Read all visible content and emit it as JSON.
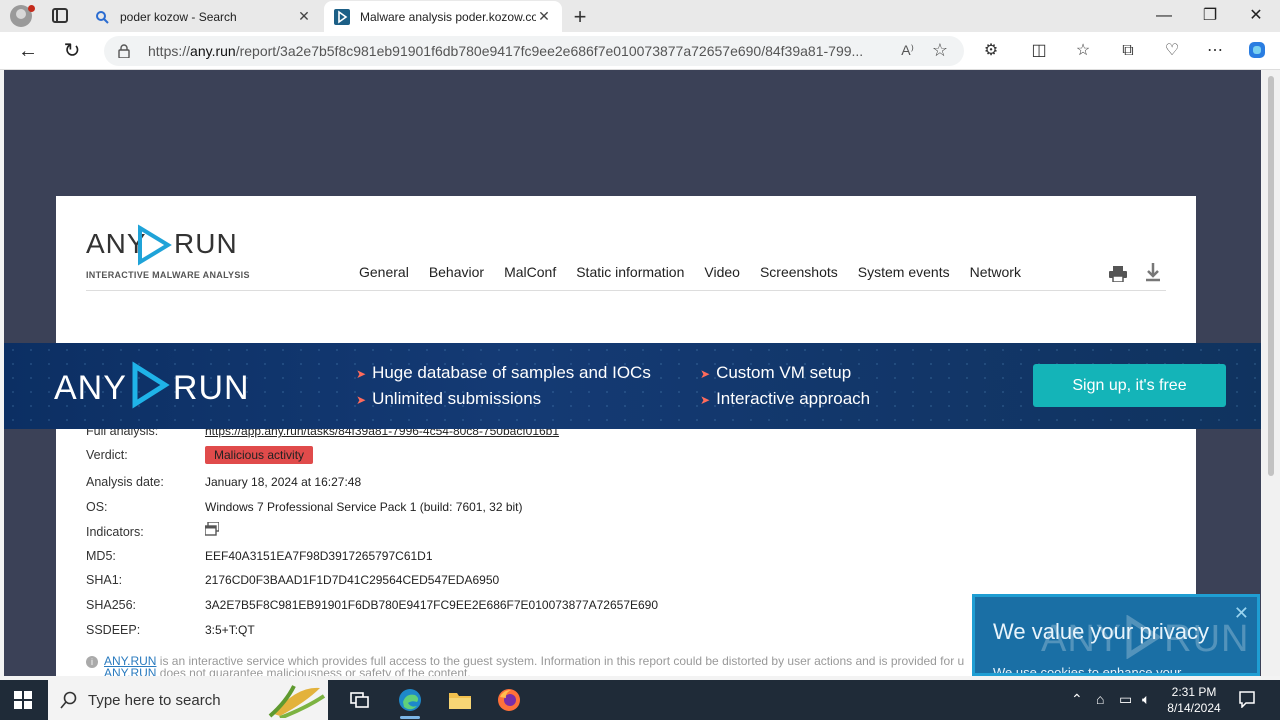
{
  "browser": {
    "tabs": [
      {
        "label": "poder kozow - Search",
        "icon": "search-icon"
      },
      {
        "label": "Malware analysis poder.kozow.co",
        "icon": "anyrun-favicon"
      }
    ],
    "url_prefix": "https://",
    "url_domain": "any.run",
    "url_rest": "/report/3a2e7b5f8c981eb91901f6db780e9417fc9ee2e686f7e010073877a72657e690/84f39a81-799...",
    "read_aloud": "A⁾"
  },
  "report": {
    "logo_text_left": "ANY",
    "logo_text_right": "RUN",
    "logo_sub": "INTERACTIVE MALWARE ANALYSIS",
    "menu": [
      "General",
      "Behavior",
      "MalConf",
      "Static information",
      "Video",
      "Screenshots",
      "System events",
      "Network"
    ],
    "rows": [
      {
        "key": "Full analysis:",
        "value": "https://app.any.run/tasks/84f39a81-7996-4c54-80c8-750bacf016b1"
      },
      {
        "key": "Verdict:",
        "value": "Malicious activity"
      },
      {
        "key": "Analysis date:",
        "value": "January 18, 2024 at 16:27:48"
      },
      {
        "key": "OS:",
        "value": "Windows 7 Professional Service Pack 1 (build: 7601, 32 bit)"
      },
      {
        "key": "Indicators:",
        "value": ""
      },
      {
        "key": "MD5:",
        "value": "EEF40A3151EA7F98D3917265797C61D1"
      },
      {
        "key": "SHA1:",
        "value": "2176CD0F3BAAD1F1D7D41C29564CED547EDA6950"
      },
      {
        "key": "SHA256:",
        "value": "3A2E7B5F8C981EB91901F6DB780E9417FC9EE2E686F7E010073877A72657E690"
      },
      {
        "key": "SSDEEP:",
        "value": "3:5+T:QT"
      }
    ],
    "notice_link": "ANY.RUN",
    "notice_text": " is an interactive service which provides full access to the guest system. Information in this report could be distorted by user actions and is provided for u",
    "notice_link2": "ANY.RUN",
    "notice_text2": " does not guarantee maliciousness or safety of the content."
  },
  "banner": {
    "logo_left": "ANY",
    "logo_right": "RUN",
    "features": [
      "Huge database of samples and IOCs",
      "Unlimited submissions",
      "Custom VM setup",
      "Interactive approach"
    ],
    "signup": "Sign up, it's free"
  },
  "cookie": {
    "title": "We value your privacy",
    "text": "We use cookies to enhance your"
  },
  "taskbar": {
    "search_placeholder": "Type here to search",
    "time": "2:31 PM",
    "date": "8/14/2024"
  },
  "colors": {
    "verdict_bg": "#e04b4b",
    "signup_bg": "#14b4b8",
    "banner_bg": "#0c2f63",
    "page_bg": "#3b4157"
  }
}
